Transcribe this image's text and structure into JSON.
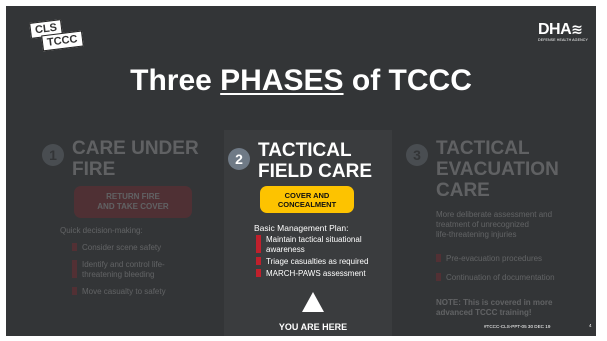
{
  "logo": {
    "line1": "CLS",
    "line2": "TCCC"
  },
  "agency": {
    "mark": "DHA",
    "name": "DEFENSE HEALTH AGENCY"
  },
  "title": {
    "prefix": "Three ",
    "emphasis": "PHASES",
    "suffix": " of TCCC"
  },
  "phases": [
    {
      "number": "1",
      "heading_line1": "CARE UNDER",
      "heading_line2": "FIRE",
      "button_line1": "RETURN FIRE",
      "button_line2": "AND TAKE COVER",
      "intro": "Quick decision-making:",
      "items": [
        "Consider scene safety",
        "Identify and control life-",
        "threatening bleeding",
        "Move casualty to safety"
      ]
    },
    {
      "number": "2",
      "heading_line1": "TACTICAL",
      "heading_line2": "FIELD CARE",
      "pill_line1": "COVER AND",
      "pill_line2": "CONCEALMENT",
      "intro": "Basic Management Plan:",
      "items": [
        "Maintain tactical situational",
        "awareness",
        "Triage casualties as required",
        "MARCH-PAWS assessment"
      ]
    },
    {
      "number": "3",
      "heading_line1": "TACTICAL",
      "heading_line2": "EVACUATION",
      "heading_line3": "CARE",
      "desc_line1": "More deliberate assessment and",
      "desc_line2": "treatment of unrecognized",
      "desc_line3": "life-threatening injuries",
      "items": [
        "Pre-evacuation procedures",
        "Continuation of documentation"
      ],
      "note_line1": "NOTE: This is covered in more",
      "note_line2": "advanced TCCC training!"
    }
  ],
  "marker": "YOU ARE HERE",
  "footer": "#TCCC-CLS-PPT-05 30 DEC 19",
  "page": "4",
  "colors": {
    "background": "#333537",
    "accent_red": "#b21f2a",
    "accent_yellow": "#fdc300",
    "number_badge": "#6f7a86"
  }
}
